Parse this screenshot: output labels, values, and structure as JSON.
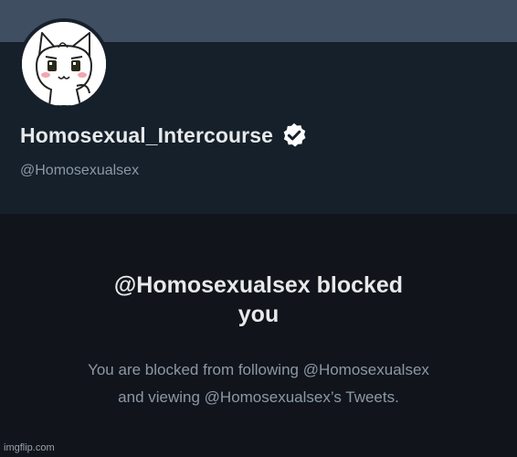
{
  "profile": {
    "display_name": "Homosexual_Intercourse",
    "handle": "@Homosexualsex",
    "verified": true
  },
  "blocked_notice": {
    "title_line1": "@Homosexualsex blocked",
    "title_line2": "you",
    "description_line1": "You are blocked from following @Homosexualsex",
    "description_line2": "and viewing @Homosexualsex’s Tweets."
  },
  "watermark": "imgflip.com",
  "colors": {
    "background": "#15202b",
    "banner": "#3f4f61",
    "blocked_bg": "#11151b",
    "primary_text": "#e7e9ea",
    "secondary_text": "#8b98a5"
  }
}
